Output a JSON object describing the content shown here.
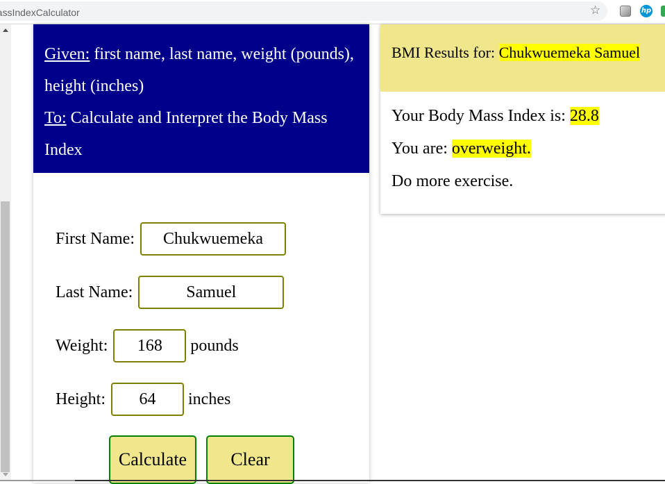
{
  "browser": {
    "url_text": "MassIndexCalculator",
    "icons": [
      "star-icon",
      "extension-cube-icon",
      "hp-extension-icon",
      "green-extension-icon"
    ],
    "hp_label": "hp"
  },
  "task": {
    "given_label": "Given:",
    "given_text": " first name, last name, weight (pounds), height (inches)",
    "to_label": "To:",
    "to_text": " Calculate and Interpret the Body Mass Index"
  },
  "form": {
    "first_name": {
      "label": "First Name:",
      "value": "Chukwuemeka"
    },
    "last_name": {
      "label": "Last Name:",
      "value": "Samuel"
    },
    "weight": {
      "label": "Weight:",
      "value": "168",
      "unit": "pounds"
    },
    "height": {
      "label": "Height:",
      "value": "64",
      "unit": "inches"
    },
    "calculate_label": "Calculate",
    "clear_label": "Clear"
  },
  "results": {
    "title_prefix": "BMI Results for: ",
    "name": "Chukwuemeka Samuel",
    "bmi_prefix": "Your Body Mass Index is: ",
    "bmi_value": "28.8",
    "status_prefix": "You are: ",
    "status_value": "overweight.",
    "advice": "Do more exercise."
  },
  "colors": {
    "header_bg": "#00008b",
    "result_header_bg": "#f0e68c",
    "highlight": "#ffff00",
    "input_border": "#808000",
    "button_border": "#008000",
    "button_bg": "#f0e68c"
  }
}
